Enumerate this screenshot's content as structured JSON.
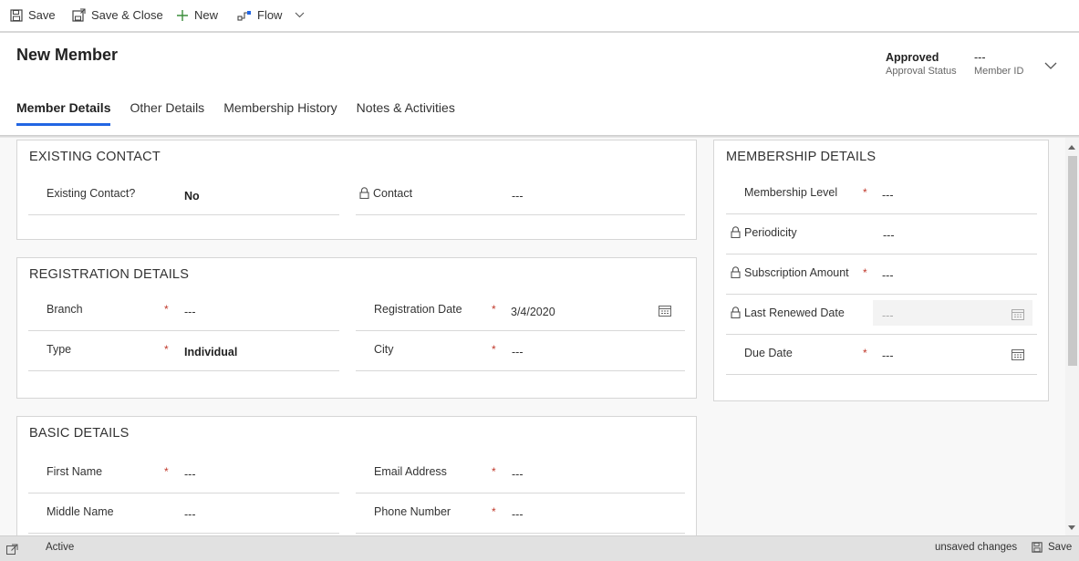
{
  "toolbar": {
    "save_label": "Save",
    "save_close_label": "Save & Close",
    "new_label": "New",
    "flow_label": "Flow"
  },
  "header": {
    "title": "New Member",
    "approval_status_value": "Approved",
    "approval_status_label": "Approval Status",
    "member_id_value": "---",
    "member_id_label": "Member ID"
  },
  "tabs": [
    {
      "label": "Member Details"
    },
    {
      "label": "Other Details"
    },
    {
      "label": "Membership History"
    },
    {
      "label": "Notes & Activities"
    }
  ],
  "existing_contact": {
    "title": "EXISTING CONTACT",
    "existing_label": "Existing Contact?",
    "existing_value": "No",
    "contact_label": "Contact",
    "contact_value": "---"
  },
  "registration": {
    "title": "REGISTRATION DETAILS",
    "branch_label": "Branch",
    "branch_value": "---",
    "reg_date_label": "Registration Date",
    "reg_date_value": "3/4/2020",
    "type_label": "Type",
    "type_value": "Individual",
    "city_label": "City",
    "city_value": "---"
  },
  "basic": {
    "title": "BASIC DETAILS",
    "first_name_label": "First Name",
    "first_name_value": "---",
    "email_label": "Email Address",
    "email_value": "---",
    "middle_name_label": "Middle Name",
    "middle_name_value": "---",
    "phone_label": "Phone Number",
    "phone_value": "---"
  },
  "membership": {
    "title": "MEMBERSHIP DETAILS",
    "level_label": "Membership Level",
    "level_value": "---",
    "periodicity_label": "Periodicity",
    "periodicity_value": "---",
    "subscription_label": "Subscription Amount",
    "subscription_value": "---",
    "renewed_label": "Last Renewed Date",
    "renewed_value": "---",
    "due_label": "Due Date",
    "due_value": "---"
  },
  "footer": {
    "status": "Active",
    "unsaved": "unsaved changes",
    "save_label": "Save"
  },
  "colors": {
    "accent": "#2266e3",
    "required": "#c0392b",
    "flow_icon": "#2266e3"
  },
  "icons": [
    "save-icon",
    "save-close-icon",
    "plus-icon",
    "flow-icon",
    "chevron-down-icon",
    "lock-icon",
    "calendar-icon",
    "popout-icon"
  ]
}
